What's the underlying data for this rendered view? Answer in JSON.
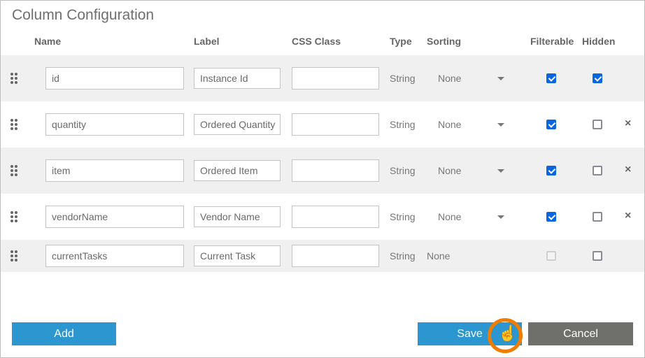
{
  "title": "Column Configuration",
  "headers": {
    "name": "Name",
    "label": "Label",
    "css": "CSS Class",
    "type": "Type",
    "sorting": "Sorting",
    "filterable": "Filterable",
    "hidden": "Hidden"
  },
  "rows": [
    {
      "name": "id",
      "label": "Instance Id",
      "css": "",
      "type": "String",
      "sorting": "None",
      "sort_dropdown": true,
      "filterable": true,
      "filterable_disabled": false,
      "hidden": true,
      "deletable": false
    },
    {
      "name": "quantity",
      "label": "Ordered Quantity",
      "css": "",
      "type": "String",
      "sorting": "None",
      "sort_dropdown": true,
      "filterable": true,
      "filterable_disabled": false,
      "hidden": false,
      "deletable": true
    },
    {
      "name": "item",
      "label": "Ordered Item",
      "css": "",
      "type": "String",
      "sorting": "None",
      "sort_dropdown": true,
      "filterable": true,
      "filterable_disabled": false,
      "hidden": false,
      "deletable": true
    },
    {
      "name": "vendorName",
      "label": "Vendor Name",
      "css": "",
      "type": "String",
      "sorting": "None",
      "sort_dropdown": true,
      "filterable": true,
      "filterable_disabled": false,
      "hidden": false,
      "deletable": true
    },
    {
      "name": "currentTasks",
      "label": "Current Task",
      "css": "",
      "type": "String",
      "sorting": "None",
      "sort_dropdown": false,
      "filterable": false,
      "filterable_disabled": true,
      "hidden": false,
      "deletable": false
    }
  ],
  "delete_glyph": "×",
  "buttons": {
    "add": "Add",
    "save": "Save",
    "cancel": "Cancel"
  },
  "colors": {
    "primary": "#2b96cf",
    "cancel": "#6f706c",
    "checkbox": "#0a66e0",
    "cursor_highlight": "#f07c00"
  }
}
